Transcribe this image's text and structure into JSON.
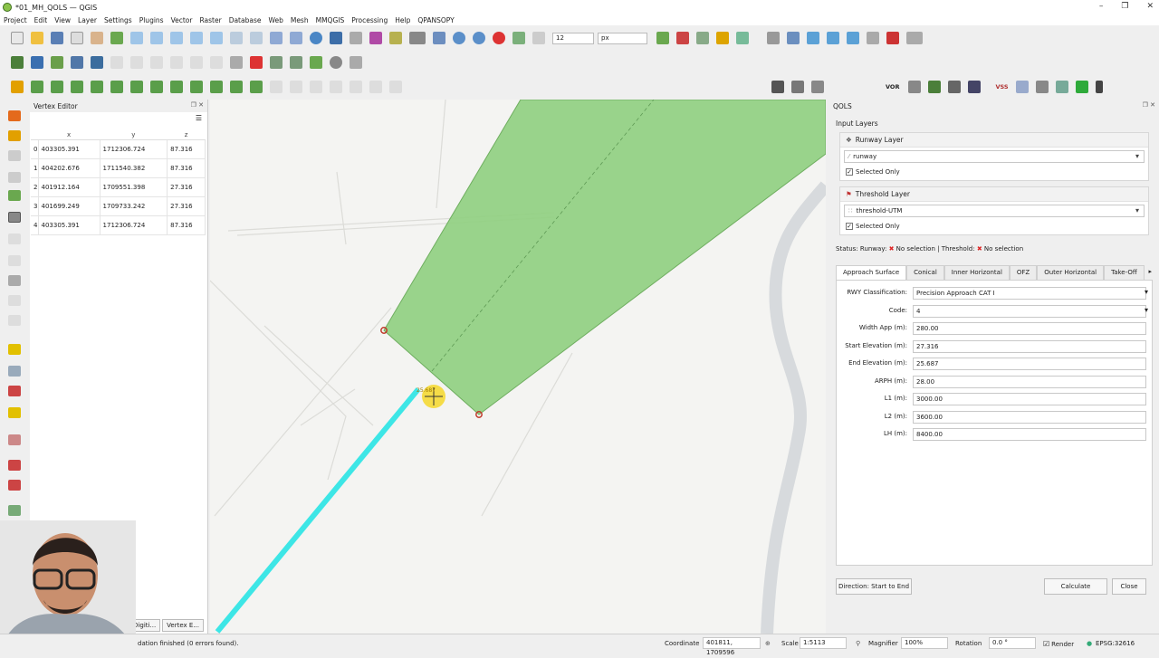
{
  "window": {
    "title": "*01_MH_QOLS — QGIS"
  },
  "menubar": [
    "Project",
    "Edit",
    "View",
    "Layer",
    "Settings",
    "Plugins",
    "Vector",
    "Raster",
    "Database",
    "Web",
    "Mesh",
    "MMQGIS",
    "Processing",
    "Help",
    "QPANSOPY"
  ],
  "toolbar": {
    "size_value": "12",
    "unit_value": "px"
  },
  "map_toolbar_labels": {
    "vor": "VOR",
    "vss": "VSS"
  },
  "vertex_editor": {
    "title": "Vertex Editor",
    "columns": [
      "x",
      "y",
      "z"
    ],
    "rows": [
      {
        "i": "0",
        "x": "403305.391",
        "y": "1712306.724",
        "z": "87.316"
      },
      {
        "i": "1",
        "x": "404202.676",
        "y": "1711540.382",
        "z": "87.316"
      },
      {
        "i": "2",
        "x": "401912.164",
        "y": "1709551.398",
        "z": "27.316"
      },
      {
        "i": "3",
        "x": "401699.249",
        "y": "1709733.242",
        "z": "27.316"
      },
      {
        "i": "4",
        "x": "403305.391",
        "y": "1712306.724",
        "z": "87.316"
      }
    ],
    "bottom_tabs": [
      "Digiti...",
      "Vertex E..."
    ]
  },
  "map": {
    "cursor_label": "25.687"
  },
  "qols": {
    "title": "QOLS",
    "input_layers_label": "Input Layers",
    "runway_group": {
      "title": "Runway Layer",
      "layer": "runway",
      "selected_only": "Selected Only"
    },
    "threshold_group": {
      "title": "Threshold Layer",
      "layer": "threshold-UTM",
      "selected_only": "Selected Only"
    },
    "status": {
      "label": "Status: Runway:",
      "runway": "No selection",
      "sep": "| Threshold:",
      "threshold": "No selection"
    },
    "tabs": [
      "Approach Surface",
      "Conical",
      "Inner Horizontal",
      "OFZ",
      "Outer Horizontal",
      "Take-Off"
    ],
    "fields": [
      {
        "label": "RWY Classification:",
        "value": "Precision Approach CAT I",
        "combo": true
      },
      {
        "label": "Code:",
        "value": "4",
        "combo": true
      },
      {
        "label": "Width App (m):",
        "value": "280.00"
      },
      {
        "label": "Start Elevation (m):",
        "value": "27.316"
      },
      {
        "label": "End Elevation (m):",
        "value": "25.687"
      },
      {
        "label": "ARPH (m):",
        "value": "28.00"
      },
      {
        "label": "L1 (m):",
        "value": "3000.00"
      },
      {
        "label": "L2 (m):",
        "value": "3600.00"
      },
      {
        "label": "LH (m):",
        "value": "8400.00"
      }
    ],
    "direction_button": "Direction: Start to End",
    "calculate_button": "Calculate",
    "close_button": "Close"
  },
  "statusbar": {
    "message": "dation finished (0 errors found).",
    "coordinate_label": "Coordinate",
    "coordinate_value": "401811, 1709596",
    "scale_label": "Scale",
    "scale_value": "1:5113",
    "magnifier_label": "Magnifier",
    "magnifier_value": "100%",
    "rotation_label": "Rotation",
    "rotation_value": "0.0 °",
    "render_label": "Render",
    "crs": "EPSG:32616"
  }
}
